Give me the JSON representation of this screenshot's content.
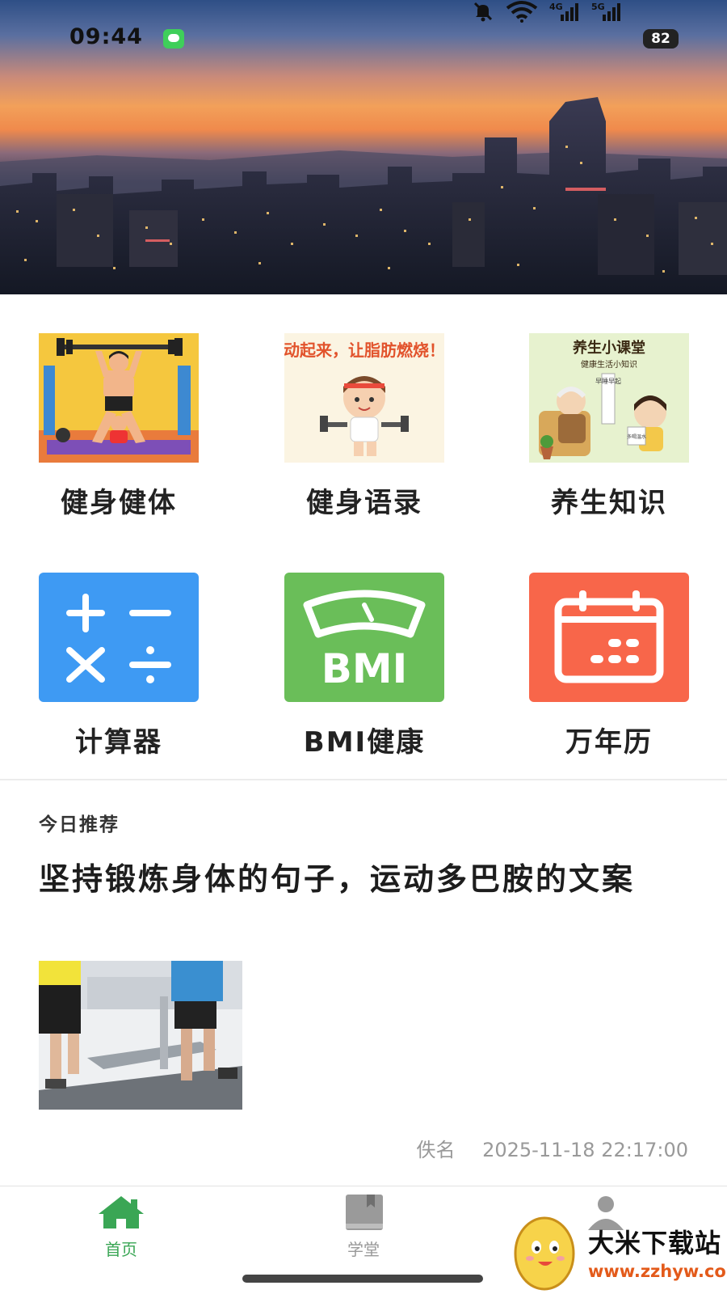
{
  "status_bar": {
    "time": "09:44",
    "network_4g": "4G",
    "network_5g": "5G",
    "battery": "82",
    "colors": {
      "message_icon": "#3fcf5a"
    }
  },
  "grid": {
    "items": [
      {
        "label": "健身健体",
        "icon": "fitness-illustration"
      },
      {
        "label": "健身语录",
        "icon": "fitness-quotes-illustration",
        "image_text": "动起来，让脂肪燃烧！"
      },
      {
        "label": "养生知识",
        "icon": "health-knowledge-illustration",
        "image_text": "养生小课堂",
        "image_subtext": "健康生活小知识",
        "image_sign": "早睡早起",
        "image_cup": "多喝温水"
      },
      {
        "label": "计算器",
        "icon": "calculator-icon",
        "color": "#3e9af3"
      },
      {
        "label": "BMI健康",
        "icon": "bmi-scale-icon",
        "color": "#6abe59",
        "icon_text": "BMI"
      },
      {
        "label": "万年历",
        "icon": "calendar-icon",
        "color": "#f8664a"
      }
    ]
  },
  "recommendation": {
    "heading": "今日推荐",
    "title": "坚持锻炼身体的句子，运动多巴胺的文案",
    "author": "佚名",
    "datetime": "2025-11-18 22:17:00",
    "image": "treadmill-photo"
  },
  "tabbar": {
    "tabs": [
      {
        "label": "首页",
        "icon": "home-icon",
        "active": true
      },
      {
        "label": "学堂",
        "icon": "book-icon",
        "active": false
      },
      {
        "label": "",
        "icon": "profile-icon",
        "active": false
      }
    ],
    "colors": {
      "active": "#3aa655",
      "inactive": "#999999"
    }
  },
  "watermark": {
    "brand": "大米下载站",
    "url": "www.zzhyw.com"
  }
}
